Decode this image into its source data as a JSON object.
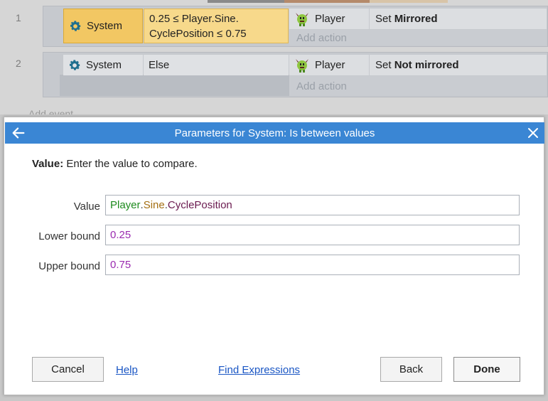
{
  "event_sheet": {
    "events": [
      {
        "number": "1",
        "condition_object": "System",
        "condition_text_line1": "0.25 ≤ Player.Sine.",
        "condition_text_line2": "CyclePosition ≤ 0.75",
        "action_object": "Player",
        "action_prefix": "Set ",
        "action_value": "Mirrored",
        "add_action": "Add action"
      },
      {
        "number": "2",
        "condition_object": "System",
        "condition_text": "Else",
        "action_object": "Player",
        "action_prefix": "Set ",
        "action_value": "Not mirrored",
        "add_action": "Add action"
      }
    ],
    "add_event": "Add event"
  },
  "dialog": {
    "title": "Parameters for System: Is between values",
    "description_label": "Value:",
    "description_text": " Enter the value to compare.",
    "params": [
      {
        "label": "Value",
        "tokens": [
          "Player",
          ".",
          "Sine",
          ".",
          "CyclePosition"
        ]
      },
      {
        "label": "Lower bound",
        "value": "0.25"
      },
      {
        "label": "Upper bound",
        "value": "0.75"
      }
    ],
    "buttons": {
      "cancel": "Cancel",
      "help": "Help",
      "find_expressions": "Find Expressions",
      "back": "Back",
      "done": "Done"
    }
  },
  "colors": {
    "titlebar": "#3a86d4",
    "highlight_condition": "#f2c763",
    "object_token": "#1d8a1d",
    "behavior_token": "#a46f12",
    "expression_token": "#6a1a4f",
    "number_token": "#9b2bb0",
    "link": "#1a56c4"
  },
  "icons": {
    "system": "gear-icon",
    "player": "player-sprite-icon",
    "back": "arrow-left-icon",
    "close": "close-icon"
  }
}
